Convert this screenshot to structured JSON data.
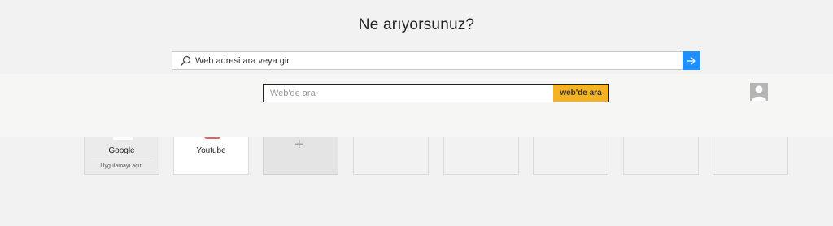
{
  "header": {
    "title": "Ne arıyorsunuz?"
  },
  "address_bar": {
    "placeholder": "Web adresi ara veya gir",
    "search_icon": "search-icon",
    "go_icon": "arrow-right-icon",
    "go_color": "#1e90ff"
  },
  "web_search": {
    "placeholder": "Web'de ara",
    "button_label": "web'de ara",
    "button_color": "#f5b324"
  },
  "profile": {
    "avatar_icon": "user-avatar-icon"
  },
  "tiles": [
    {
      "label": "Google",
      "action": "Uygulamayı açın"
    },
    {
      "label": "Youtube"
    },
    {
      "label": "",
      "icon": "plus-icon"
    },
    {
      "label": ""
    },
    {
      "label": ""
    },
    {
      "label": ""
    },
    {
      "label": ""
    },
    {
      "label": ""
    }
  ]
}
